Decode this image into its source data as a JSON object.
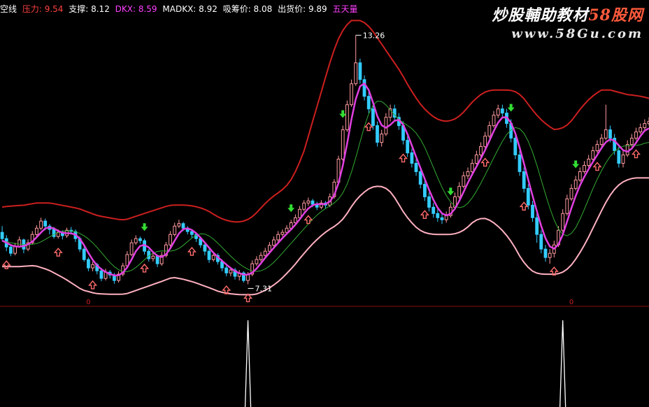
{
  "header": {
    "items": [
      {
        "label": "空线",
        "color": "#ffffff"
      },
      {
        "label": "压力: 9.54",
        "color": "#ff4040"
      },
      {
        "label": "支撑: 8.12",
        "color": "#ffffff"
      },
      {
        "label": "DKX: 8.59",
        "color": "#ff40ff"
      },
      {
        "label": "MADKX: 8.92",
        "color": "#ffffff"
      },
      {
        "label": "吸筹价: 8.08",
        "color": "#ffffff"
      },
      {
        "label": "出货价: 9.89",
        "color": "#ffffff"
      },
      {
        "label": "五天量",
        "color": "#ff40ff"
      }
    ]
  },
  "watermark": {
    "title_text": "炒股輔助教材",
    "title_brand": "58股网",
    "url": "www.58Gu.com"
  },
  "colors": {
    "background": "#000000",
    "up_candle": "#ff9aa0",
    "down_candle": "#33ccff",
    "pressure_line": "#cc1f1f",
    "support_line": "#ffb0c0",
    "dkx_line": "#e040e0",
    "madkx_line": "#33aa33",
    "buy_arrow": "#ff6b6b",
    "sell_arrow": "#33dd33",
    "separator": "#8b1010",
    "indicator_spike": "#ffffff",
    "label": "#ffffff"
  },
  "chart_data": {
    "type": "candlestick",
    "y_range": [
      7.0,
      13.6
    ],
    "n_bars": 151,
    "annotations": [
      {
        "text": "13.26",
        "bar": 82,
        "value": 13.26
      },
      {
        "text": "7.31",
        "bar": 57,
        "value": 7.31
      }
    ],
    "candles": [
      [
        8.55,
        8.4,
        8.7,
        8.35
      ],
      [
        8.4,
        8.2,
        8.48,
        8.1
      ],
      [
        8.2,
        8.05,
        8.25,
        7.98
      ],
      [
        8.05,
        8.22,
        8.3,
        8.0
      ],
      [
        8.22,
        8.37,
        8.45,
        8.18
      ],
      [
        8.37,
        8.15,
        8.4,
        8.05
      ],
      [
        8.15,
        8.3,
        8.38,
        8.1
      ],
      [
        8.3,
        8.5,
        8.58,
        8.26
      ],
      [
        8.5,
        8.65,
        8.72,
        8.45
      ],
      [
        8.65,
        8.82,
        8.9,
        8.6
      ],
      [
        8.82,
        8.7,
        8.88,
        8.6
      ],
      [
        8.7,
        8.62,
        8.75,
        8.5
      ],
      [
        8.62,
        8.45,
        8.68,
        8.4
      ],
      [
        8.45,
        8.55,
        8.62,
        8.4
      ],
      [
        8.55,
        8.47,
        8.6,
        8.38
      ],
      [
        8.47,
        8.6,
        8.66,
        8.42
      ],
      [
        8.6,
        8.57,
        8.68,
        8.5
      ],
      [
        8.57,
        8.4,
        8.62,
        8.32
      ],
      [
        8.4,
        8.15,
        8.45,
        8.08
      ],
      [
        8.15,
        7.9,
        8.2,
        7.85
      ],
      [
        7.9,
        7.7,
        7.95,
        7.62
      ],
      [
        7.7,
        7.78,
        7.85,
        7.62
      ],
      [
        7.78,
        7.63,
        7.82,
        7.55
      ],
      [
        7.63,
        7.45,
        7.7,
        7.38
      ],
      [
        7.45,
        7.6,
        7.68,
        7.4
      ],
      [
        7.6,
        7.53,
        7.65,
        7.45
      ],
      [
        7.53,
        7.4,
        7.58,
        7.32
      ],
      [
        7.4,
        7.55,
        7.62,
        7.35
      ],
      [
        7.55,
        7.75,
        7.82,
        7.5
      ],
      [
        7.75,
        8.02,
        8.1,
        7.7
      ],
      [
        8.02,
        8.3,
        8.38,
        7.98
      ],
      [
        8.3,
        8.4,
        8.48,
        8.25
      ],
      [
        8.4,
        8.35,
        8.45,
        8.28
      ],
      [
        8.35,
        8.1,
        8.4,
        8.02
      ],
      [
        8.1,
        7.92,
        8.15,
        7.85
      ],
      [
        7.92,
        7.98,
        8.05,
        7.85
      ],
      [
        7.98,
        7.8,
        8.02,
        7.72
      ],
      [
        7.8,
        8.0,
        8.08,
        7.75
      ],
      [
        8.0,
        8.25,
        8.32,
        7.95
      ],
      [
        8.25,
        8.5,
        8.58,
        8.2
      ],
      [
        8.5,
        8.7,
        8.78,
        8.45
      ],
      [
        8.7,
        8.76,
        8.85,
        8.65
      ],
      [
        8.76,
        8.65,
        8.8,
        8.58
      ],
      [
        8.65,
        8.57,
        8.7,
        8.5
      ],
      [
        8.57,
        8.5,
        8.62,
        8.42
      ],
      [
        8.5,
        8.4,
        8.55,
        8.32
      ],
      [
        8.4,
        8.25,
        8.45,
        8.18
      ],
      [
        8.25,
        8.1,
        8.3,
        8.0
      ],
      [
        8.1,
        7.9,
        8.15,
        7.82
      ],
      [
        7.9,
        8.0,
        8.08,
        7.85
      ],
      [
        8.0,
        7.85,
        8.05,
        7.78
      ],
      [
        7.85,
        7.7,
        7.9,
        7.62
      ],
      [
        7.7,
        7.58,
        7.75,
        7.5
      ],
      [
        7.58,
        7.65,
        7.72,
        7.5
      ],
      [
        7.65,
        7.5,
        7.7,
        7.42
      ],
      [
        7.5,
        7.58,
        7.65,
        7.4
      ],
      [
        7.58,
        7.4,
        7.62,
        7.35
      ],
      [
        7.4,
        7.55,
        7.6,
        7.31
      ],
      [
        7.55,
        7.8,
        7.88,
        7.5
      ],
      [
        7.8,
        7.9,
        7.98,
        7.75
      ],
      [
        7.9,
        8.0,
        8.08,
        7.85
      ],
      [
        8.0,
        8.1,
        8.18,
        7.95
      ],
      [
        8.1,
        8.24,
        8.32,
        8.05
      ],
      [
        8.24,
        8.37,
        8.45,
        8.2
      ],
      [
        8.37,
        8.5,
        8.58,
        8.32
      ],
      [
        8.5,
        8.55,
        8.62,
        8.45
      ],
      [
        8.55,
        8.65,
        8.72,
        8.5
      ],
      [
        8.65,
        8.78,
        8.85,
        8.6
      ],
      [
        8.78,
        8.9,
        8.98,
        8.72
      ],
      [
        8.9,
        9.1,
        9.18,
        8.85
      ],
      [
        9.1,
        9.25,
        9.32,
        9.05
      ],
      [
        9.25,
        9.3,
        9.38,
        9.18
      ],
      [
        9.3,
        9.22,
        9.35,
        9.15
      ],
      [
        9.22,
        9.15,
        9.28,
        9.08
      ],
      [
        9.15,
        9.25,
        9.32,
        9.1
      ],
      [
        9.25,
        9.2,
        9.3,
        9.12
      ],
      [
        9.2,
        9.4,
        9.48,
        9.15
      ],
      [
        9.4,
        9.75,
        9.82,
        9.35
      ],
      [
        9.75,
        10.3,
        10.38,
        9.7
      ],
      [
        10.3,
        11.0,
        11.1,
        10.25
      ],
      [
        11.0,
        11.6,
        11.7,
        10.95
      ],
      [
        11.6,
        12.1,
        12.2,
        11.55
      ],
      [
        12.1,
        12.6,
        13.26,
        12.05
      ],
      [
        12.6,
        12.2,
        12.7,
        12.1
      ],
      [
        12.2,
        11.8,
        12.3,
        11.7
      ],
      [
        11.8,
        11.5,
        11.9,
        11.4
      ],
      [
        11.5,
        11.1,
        11.6,
        11.0
      ],
      [
        11.1,
        10.7,
        11.2,
        10.6
      ],
      [
        10.7,
        10.9,
        11.0,
        10.6
      ],
      [
        10.9,
        11.3,
        11.4,
        10.85
      ],
      [
        11.3,
        11.5,
        11.6,
        11.2
      ],
      [
        11.5,
        11.3,
        11.6,
        11.2
      ],
      [
        11.3,
        11.1,
        11.4,
        11.0
      ],
      [
        11.1,
        10.75,
        11.2,
        10.65
      ],
      [
        10.75,
        10.45,
        10.85,
        10.35
      ],
      [
        10.45,
        10.2,
        10.55,
        10.1
      ],
      [
        10.2,
        10.0,
        10.3,
        9.9
      ],
      [
        10.0,
        9.7,
        10.1,
        9.6
      ],
      [
        9.7,
        9.4,
        9.8,
        9.3
      ],
      [
        9.4,
        9.15,
        9.5,
        9.05
      ],
      [
        9.15,
        9.0,
        9.25,
        8.9
      ],
      [
        9.0,
        8.9,
        9.1,
        8.8
      ],
      [
        8.9,
        8.85,
        9.0,
        8.75
      ],
      [
        8.85,
        8.95,
        9.05,
        8.78
      ],
      [
        8.95,
        9.15,
        9.25,
        8.9
      ],
      [
        9.15,
        9.4,
        9.5,
        9.1
      ],
      [
        9.4,
        9.65,
        9.75,
        9.35
      ],
      [
        9.65,
        9.9,
        10.0,
        9.6
      ],
      [
        9.9,
        10.0,
        10.1,
        9.82
      ],
      [
        10.0,
        10.2,
        10.3,
        9.95
      ],
      [
        10.2,
        10.4,
        10.5,
        10.15
      ],
      [
        10.4,
        10.6,
        10.7,
        10.35
      ],
      [
        10.6,
        10.85,
        10.95,
        10.55
      ],
      [
        10.85,
        11.1,
        11.2,
        10.8
      ],
      [
        11.1,
        11.35,
        11.45,
        11.05
      ],
      [
        11.35,
        11.5,
        11.6,
        11.28
      ],
      [
        11.5,
        11.4,
        11.6,
        11.3
      ],
      [
        11.4,
        11.15,
        11.5,
        11.05
      ],
      [
        11.15,
        10.8,
        11.25,
        10.7
      ],
      [
        10.8,
        10.4,
        10.9,
        10.3
      ],
      [
        10.4,
        10.0,
        10.5,
        9.9
      ],
      [
        10.0,
        9.6,
        10.1,
        9.5
      ],
      [
        9.6,
        9.2,
        9.7,
        9.1
      ],
      [
        9.2,
        8.9,
        9.3,
        8.8
      ],
      [
        8.9,
        8.5,
        9.0,
        8.3
      ],
      [
        8.5,
        8.15,
        8.6,
        8.05
      ],
      [
        8.15,
        7.95,
        8.25,
        7.85
      ],
      [
        7.95,
        8.05,
        8.15,
        7.8
      ],
      [
        8.05,
        8.25,
        8.35,
        7.95
      ],
      [
        8.25,
        8.6,
        8.7,
        8.2
      ],
      [
        8.6,
        9.0,
        9.1,
        8.55
      ],
      [
        9.0,
        9.35,
        9.45,
        8.95
      ],
      [
        9.35,
        9.6,
        9.7,
        9.3
      ],
      [
        9.6,
        9.8,
        9.9,
        9.55
      ],
      [
        9.8,
        10.0,
        10.1,
        9.75
      ],
      [
        10.0,
        10.15,
        10.25,
        9.95
      ],
      [
        10.15,
        10.3,
        10.4,
        10.1
      ],
      [
        10.3,
        10.5,
        10.6,
        10.25
      ],
      [
        10.5,
        10.65,
        10.75,
        10.45
      ],
      [
        10.65,
        10.8,
        10.9,
        10.6
      ],
      [
        10.8,
        11.0,
        11.6,
        10.75
      ],
      [
        11.0,
        10.8,
        11.1,
        10.7
      ],
      [
        10.8,
        10.5,
        10.9,
        10.4
      ],
      [
        10.5,
        10.2,
        10.6,
        10.1
      ],
      [
        10.2,
        10.4,
        10.5,
        10.1
      ],
      [
        10.4,
        10.65,
        10.75,
        10.35
      ],
      [
        10.65,
        10.8,
        10.9,
        10.6
      ],
      [
        10.8,
        10.95,
        11.05,
        10.75
      ],
      [
        10.95,
        11.05,
        11.15,
        10.9
      ],
      [
        11.05,
        11.15,
        11.25,
        11.0
      ],
      [
        11.15,
        11.2,
        11.3,
        11.1
      ]
    ],
    "sell_signals": [
      33,
      67,
      79,
      104,
      118,
      133
    ],
    "buy_signals": [
      1,
      13,
      21,
      33,
      44,
      52,
      57,
      71,
      85,
      93,
      98,
      112,
      121,
      128,
      138,
      147
    ],
    "indicator_spikes": [
      57,
      130
    ],
    "zero_markers": [
      {
        "text": "0",
        "bar": 20
      },
      {
        "text": "0",
        "bar": 132
      }
    ]
  }
}
